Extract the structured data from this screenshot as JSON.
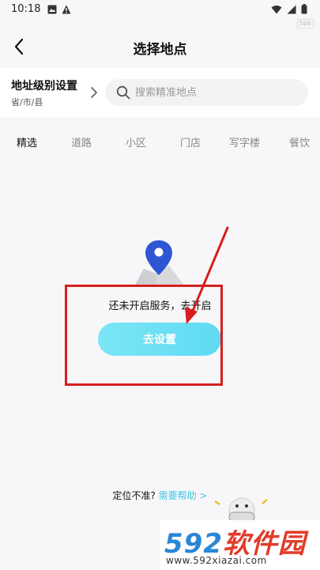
{
  "status_bar": {
    "time": "10:18",
    "left_icons": [
      "image-icon",
      "alert-icon"
    ],
    "right_icons": [
      "wifi-icon",
      "signal-icon",
      "battery-icon"
    ],
    "tag": "5bb"
  },
  "nav": {
    "title": "选择地点",
    "back_icon": "chevron-left-icon"
  },
  "address_level": {
    "title": "地址级别设置",
    "subtitle": "省/市/县"
  },
  "search": {
    "placeholder": "搜索精准地点",
    "value": ""
  },
  "tabs": [
    {
      "label": "精选",
      "active": true
    },
    {
      "label": "道路",
      "active": false
    },
    {
      "label": "小区",
      "active": false
    },
    {
      "label": "门店",
      "active": false
    },
    {
      "label": "写字楼",
      "active": false
    },
    {
      "label": "餐饮",
      "active": false
    }
  ],
  "empty_state": {
    "message": "还未开启服务，去开启",
    "button_label": "去设置"
  },
  "help": {
    "prefix": "定位不准?",
    "link": "需要帮助 >"
  },
  "watermark": {
    "number": "592",
    "brand": "软件园",
    "url": "www.592xiazai.com"
  },
  "colors": {
    "accent": "#5fdaf2",
    "pin": "#2f55d4",
    "highlight": "#d81e1e",
    "link": "#3fc4e6"
  }
}
